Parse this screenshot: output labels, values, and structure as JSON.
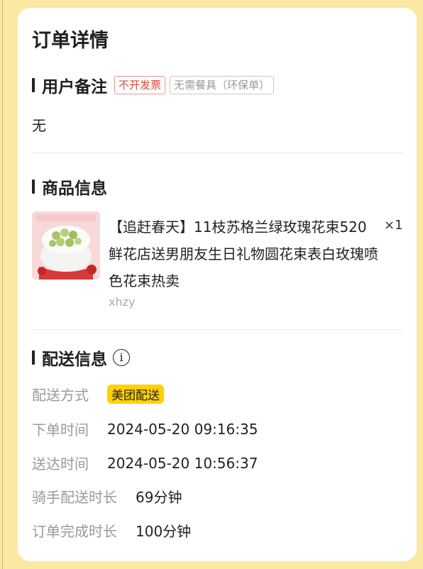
{
  "page": {
    "title": "订单详情"
  },
  "remarks": {
    "section_title": "用户备注",
    "tags": [
      "不开发票",
      "无需餐具（环保单）"
    ],
    "note": "无"
  },
  "product": {
    "section_title": "商品信息",
    "name": "【追赶春天】11枝苏格兰绿玫瑰花束520鲜花店送男朋友生日礼物圆花束表白玫瑰喷色花束热卖",
    "quantity": "×1",
    "spec": "xhzy",
    "thumbnail_icon": "flower-bouquet-thumbnail"
  },
  "delivery": {
    "section_title": "配送信息",
    "info_icon": "info-icon",
    "rows": [
      {
        "label": "配送方式",
        "value": "美团配送"
      },
      {
        "label": "下单时间",
        "value": "2024-05-20 09:16:35"
      },
      {
        "label": "送达时间",
        "value": "2024-05-20 10:56:37"
      },
      {
        "label": "骑手配送时长",
        "value": "69分钟"
      },
      {
        "label": "订单完成时长",
        "value": "100分钟"
      }
    ]
  },
  "colors": {
    "background": "#fbe9a3",
    "accent_badge": "#ffd100",
    "tag_red": "#e0463a"
  }
}
